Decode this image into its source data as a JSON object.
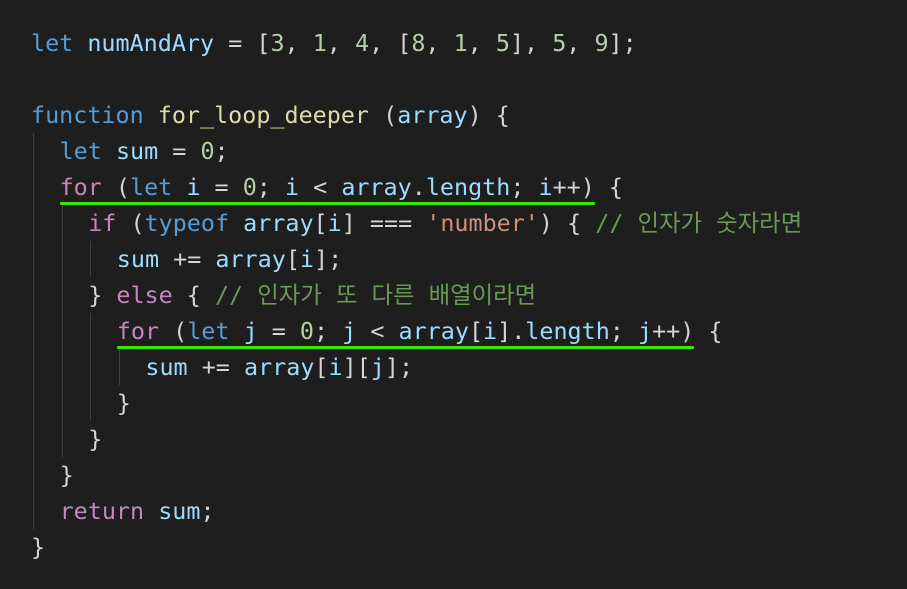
{
  "editor": {
    "lines": [
      {
        "indent": 0,
        "tokens": [
          {
            "text": "let",
            "kind": "kw-blue"
          },
          {
            "text": " ",
            "kind": "op"
          },
          {
            "text": "numAndAry",
            "kind": "var"
          },
          {
            "text": " = [",
            "kind": "op"
          },
          {
            "text": "3",
            "kind": "num"
          },
          {
            "text": ", ",
            "kind": "op"
          },
          {
            "text": "1",
            "kind": "num"
          },
          {
            "text": ", ",
            "kind": "op"
          },
          {
            "text": "4",
            "kind": "num"
          },
          {
            "text": ", [",
            "kind": "op"
          },
          {
            "text": "8",
            "kind": "num"
          },
          {
            "text": ", ",
            "kind": "op"
          },
          {
            "text": "1",
            "kind": "num"
          },
          {
            "text": ", ",
            "kind": "op"
          },
          {
            "text": "5",
            "kind": "num"
          },
          {
            "text": "], ",
            "kind": "op"
          },
          {
            "text": "5",
            "kind": "num"
          },
          {
            "text": ", ",
            "kind": "op"
          },
          {
            "text": "9",
            "kind": "num"
          },
          {
            "text": "];",
            "kind": "op"
          }
        ]
      },
      {
        "indent": 0,
        "tokens": []
      },
      {
        "indent": 0,
        "tokens": [
          {
            "text": "function",
            "kind": "kw-blue"
          },
          {
            "text": " ",
            "kind": "op"
          },
          {
            "text": "for_loop_deeper",
            "kind": "fn"
          },
          {
            "text": " (",
            "kind": "op"
          },
          {
            "text": "array",
            "kind": "var"
          },
          {
            "text": ") {",
            "kind": "op"
          }
        ]
      },
      {
        "indent": 1,
        "tokens": [
          {
            "text": "let",
            "kind": "kw-blue"
          },
          {
            "text": " ",
            "kind": "op"
          },
          {
            "text": "sum",
            "kind": "var"
          },
          {
            "text": " = ",
            "kind": "op"
          },
          {
            "text": "0",
            "kind": "num"
          },
          {
            "text": ";",
            "kind": "op"
          }
        ]
      },
      {
        "indent": 1,
        "tokens": [
          {
            "text": "for",
            "kind": "kw-ctrl"
          },
          {
            "text": " (",
            "kind": "op"
          },
          {
            "text": "let",
            "kind": "kw-blue"
          },
          {
            "text": " ",
            "kind": "op"
          },
          {
            "text": "i",
            "kind": "var"
          },
          {
            "text": " = ",
            "kind": "op"
          },
          {
            "text": "0",
            "kind": "num"
          },
          {
            "text": "; ",
            "kind": "op"
          },
          {
            "text": "i",
            "kind": "var"
          },
          {
            "text": " < ",
            "kind": "op"
          },
          {
            "text": "array",
            "kind": "var"
          },
          {
            "text": ".",
            "kind": "op"
          },
          {
            "text": "length",
            "kind": "var"
          },
          {
            "text": "; ",
            "kind": "op"
          },
          {
            "text": "i",
            "kind": "var"
          },
          {
            "text": "++) {",
            "kind": "op"
          }
        ]
      },
      {
        "indent": 2,
        "tokens": [
          {
            "text": "if",
            "kind": "kw-ctrl"
          },
          {
            "text": " (",
            "kind": "op"
          },
          {
            "text": "typeof",
            "kind": "kw-blue"
          },
          {
            "text": " ",
            "kind": "op"
          },
          {
            "text": "array",
            "kind": "var"
          },
          {
            "text": "[",
            "kind": "op"
          },
          {
            "text": "i",
            "kind": "var"
          },
          {
            "text": "] === ",
            "kind": "op"
          },
          {
            "text": "'number'",
            "kind": "str"
          },
          {
            "text": ") { ",
            "kind": "op"
          },
          {
            "text": "// 인자가 숫자라면",
            "kind": "cmt"
          }
        ]
      },
      {
        "indent": 3,
        "tokens": [
          {
            "text": "sum",
            "kind": "var"
          },
          {
            "text": " += ",
            "kind": "op"
          },
          {
            "text": "array",
            "kind": "var"
          },
          {
            "text": "[",
            "kind": "op"
          },
          {
            "text": "i",
            "kind": "var"
          },
          {
            "text": "];",
            "kind": "op"
          }
        ]
      },
      {
        "indent": 2,
        "tokens": [
          {
            "text": "} ",
            "kind": "op"
          },
          {
            "text": "else",
            "kind": "kw-ctrl"
          },
          {
            "text": " { ",
            "kind": "op"
          },
          {
            "text": "// 인자가 또 다른 배열이라면",
            "kind": "cmt"
          }
        ]
      },
      {
        "indent": 3,
        "tokens": [
          {
            "text": "for",
            "kind": "kw-ctrl"
          },
          {
            "text": " (",
            "kind": "op"
          },
          {
            "text": "let",
            "kind": "kw-blue"
          },
          {
            "text": " ",
            "kind": "op"
          },
          {
            "text": "j",
            "kind": "var"
          },
          {
            "text": " = ",
            "kind": "op"
          },
          {
            "text": "0",
            "kind": "num"
          },
          {
            "text": "; ",
            "kind": "op"
          },
          {
            "text": "j",
            "kind": "var"
          },
          {
            "text": " < ",
            "kind": "op"
          },
          {
            "text": "array",
            "kind": "var"
          },
          {
            "text": "[",
            "kind": "op"
          },
          {
            "text": "i",
            "kind": "var"
          },
          {
            "text": "].",
            "kind": "op"
          },
          {
            "text": "length",
            "kind": "var"
          },
          {
            "text": "; ",
            "kind": "op"
          },
          {
            "text": "j",
            "kind": "var"
          },
          {
            "text": "++) {",
            "kind": "op"
          }
        ]
      },
      {
        "indent": 4,
        "tokens": [
          {
            "text": "sum",
            "kind": "var"
          },
          {
            "text": " += ",
            "kind": "op"
          },
          {
            "text": "array",
            "kind": "var"
          },
          {
            "text": "[",
            "kind": "op"
          },
          {
            "text": "i",
            "kind": "var"
          },
          {
            "text": "][",
            "kind": "op"
          },
          {
            "text": "j",
            "kind": "var"
          },
          {
            "text": "];",
            "kind": "op"
          }
        ]
      },
      {
        "indent": 3,
        "tokens": [
          {
            "text": "}",
            "kind": "op"
          }
        ]
      },
      {
        "indent": 2,
        "tokens": [
          {
            "text": "}",
            "kind": "op"
          }
        ]
      },
      {
        "indent": 1,
        "tokens": [
          {
            "text": "}",
            "kind": "op"
          }
        ]
      },
      {
        "indent": 1,
        "tokens": [
          {
            "text": "return",
            "kind": "kw-ctrl"
          },
          {
            "text": " ",
            "kind": "op"
          },
          {
            "text": "sum",
            "kind": "var"
          },
          {
            "text": ";",
            "kind": "op"
          }
        ]
      },
      {
        "indent": 0,
        "tokens": [
          {
            "text": "}",
            "kind": "op"
          }
        ]
      }
    ],
    "highlighted_lines": [
      4,
      8
    ],
    "colors": {
      "background": "#1e1e1e",
      "highlight_underline": "#39e600",
      "keyword_blue": "#569cd6",
      "keyword_control": "#c586c0",
      "variable": "#9cdcfe",
      "function": "#dcdcaa",
      "number": "#b5cea8",
      "string": "#ce9178",
      "comment": "#6a9955",
      "plain": "#d4d4d4"
    }
  }
}
